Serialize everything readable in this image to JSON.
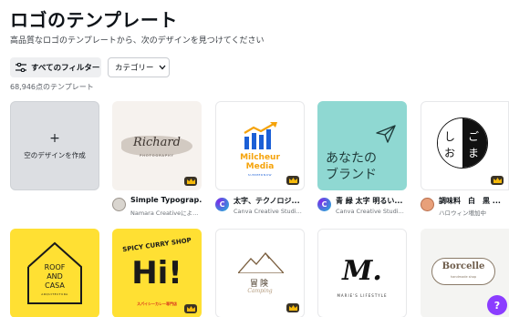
{
  "header": {
    "title": "ロゴのテンプレート",
    "subtitle": "高品質なロゴのテンプレートから、次のデザインを見つけてください"
  },
  "filters": {
    "all_filters_label": "すべてのフィルター",
    "category_label": "カテゴリー",
    "result_count": "68,946点のテンプレート"
  },
  "empty_design": {
    "plus": "+",
    "label": "空のデザインを作成"
  },
  "templates_row1": [
    {
      "name": "Simple Typograp...",
      "author": "Namara Creativeによ...",
      "script_text": "Richard",
      "sub_text": "PHOTOGRAPHY"
    },
    {
      "name": "太字、テクノロジ...",
      "author": "Canva Creative Studi...",
      "line1": "Milcheur",
      "line2": "Media",
      "line3": "SUMMERNOW"
    },
    {
      "name": "青 緑 太字 明るい...",
      "author": "Canva Creative Studi...",
      "line1": "あなたの",
      "line2": "ブランド"
    },
    {
      "name": "調味料　白　黒 ...",
      "author": "ハロウィン増加中",
      "char_a": "し",
      "char_b": "お",
      "char_c": "ご",
      "char_d": "ま"
    }
  ],
  "templates_row2": [
    {
      "line1": "ROOF",
      "line2": "AND",
      "line3": "CASA",
      "line4": "ARQUITECTURA"
    },
    {
      "top_text": "SPICY CURRY SHOP",
      "big_text": "Hi!",
      "bottom_text": "スパイシーカレー専門店"
    },
    {
      "title_text": "冒険",
      "sub_text": "Camping"
    },
    {
      "big_text": "M.",
      "sub_text": "MARIE'S LIFESTYLE"
    },
    {
      "big_text": "Borcelle",
      "sub_text": "handmade shop"
    }
  ],
  "help": {
    "label": "?"
  },
  "colors": {
    "accent": "#8b3dff",
    "teal_tile": "#8fd8d2",
    "yellow_tile": "#ffe033",
    "brand_blue": "#1b5fd6",
    "curry_red": "#d62b1e"
  }
}
